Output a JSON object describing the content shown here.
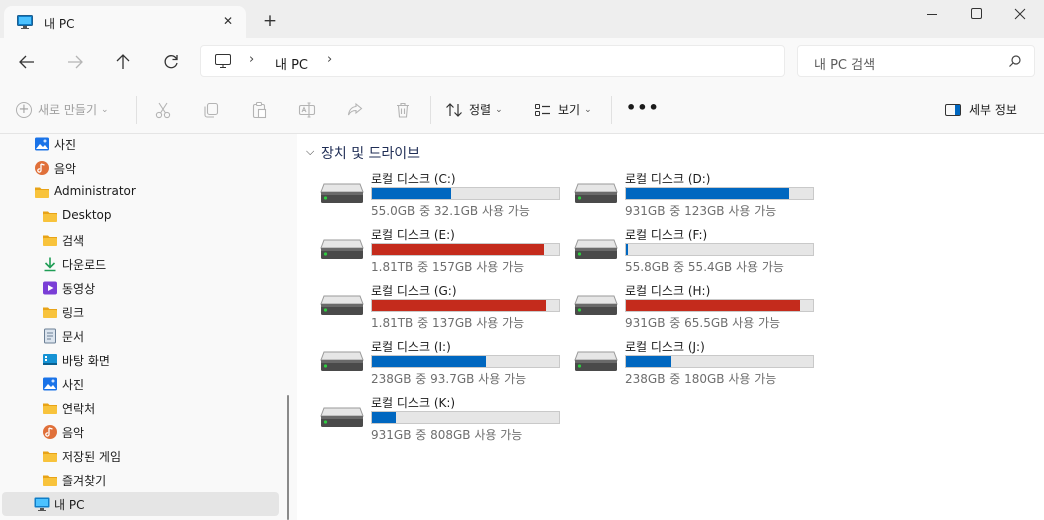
{
  "window": {
    "tab_title": "내 PC",
    "new_tab_symbol": "+",
    "close_tab_symbol": "✕",
    "min_symbol": "—",
    "max_symbol": "☐",
    "close_symbol": "✕"
  },
  "navigation": {
    "back_icon": "arrow-left-icon",
    "forward_icon": "arrow-right-icon",
    "up_icon": "arrow-up-icon",
    "refresh_icon": "refresh-icon",
    "address_segments": [
      "내 PC"
    ],
    "search_placeholder": "내 PC 검색"
  },
  "command_bar": {
    "new_label": "새로 만들기",
    "sort_label": "정렬",
    "view_label": "보기",
    "more_label": "•••",
    "details_label": "세부 정보"
  },
  "sidebar": {
    "items": [
      {
        "label": "사진",
        "icon": "pictures-icon",
        "indent": 1
      },
      {
        "label": "음악",
        "icon": "music-icon",
        "indent": 1
      },
      {
        "label": "Administrator",
        "icon": "folder-icon",
        "indent": 1
      },
      {
        "label": "Desktop",
        "icon": "folder-icon",
        "indent": 2
      },
      {
        "label": "검색",
        "icon": "folder-icon",
        "indent": 2
      },
      {
        "label": "다운로드",
        "icon": "download-icon",
        "indent": 2
      },
      {
        "label": "동영상",
        "icon": "video-icon",
        "indent": 2
      },
      {
        "label": "링크",
        "icon": "folder-icon",
        "indent": 2
      },
      {
        "label": "문서",
        "icon": "document-icon",
        "indent": 2
      },
      {
        "label": "바탕 화면",
        "icon": "desktop-icon",
        "indent": 2
      },
      {
        "label": "사진",
        "icon": "pictures-icon",
        "indent": 2
      },
      {
        "label": "연락처",
        "icon": "folder-icon",
        "indent": 2
      },
      {
        "label": "음악",
        "icon": "music-icon",
        "indent": 2
      },
      {
        "label": "저장된 게임",
        "icon": "folder-icon",
        "indent": 2
      },
      {
        "label": "즐겨찾기",
        "icon": "folder-icon",
        "indent": 2
      },
      {
        "label": "내 PC",
        "icon": "pc-icon",
        "indent": 1,
        "selected": true
      }
    ]
  },
  "content": {
    "group_title": "장치 및 드라이브",
    "drives": [
      {
        "name": "로컬 디스크 (C:)",
        "space": "55.0GB 중 32.1GB 사용 가능",
        "used_fraction": 0.42,
        "status": "normal"
      },
      {
        "name": "로컬 디스크 (D:)",
        "space": "931GB 중 123GB 사용 가능",
        "used_fraction": 0.87,
        "status": "normal"
      },
      {
        "name": "로컬 디스크 (E:)",
        "space": "1.81TB 중 157GB 사용 가능",
        "used_fraction": 0.92,
        "status": "warning"
      },
      {
        "name": "로컬 디스크 (F:)",
        "space": "55.8GB 중 55.4GB 사용 가능",
        "used_fraction": 0.01,
        "status": "normal"
      },
      {
        "name": "로컬 디스크 (G:)",
        "space": "1.81TB 중 137GB 사용 가능",
        "used_fraction": 0.93,
        "status": "warning"
      },
      {
        "name": "로컬 디스크 (H:)",
        "space": "931GB 중 65.5GB 사용 가능",
        "used_fraction": 0.93,
        "status": "warning"
      },
      {
        "name": "로컬 디스크 (I:)",
        "space": "238GB 중 93.7GB 사용 가능",
        "used_fraction": 0.61,
        "status": "normal"
      },
      {
        "name": "로컬 디스크 (J:)",
        "space": "238GB 중 180GB 사용 가능",
        "used_fraction": 0.24,
        "status": "normal"
      },
      {
        "name": "로컬 디스크 (K:)",
        "space": "931GB 중 808GB 사용 가능",
        "used_fraction": 0.13,
        "status": "normal"
      }
    ]
  },
  "colors": {
    "normal_bar": "#0067c0",
    "warning_bar": "#c42b1c",
    "selected_bg": "#e5e5e5",
    "folder": "#f8c33c"
  }
}
